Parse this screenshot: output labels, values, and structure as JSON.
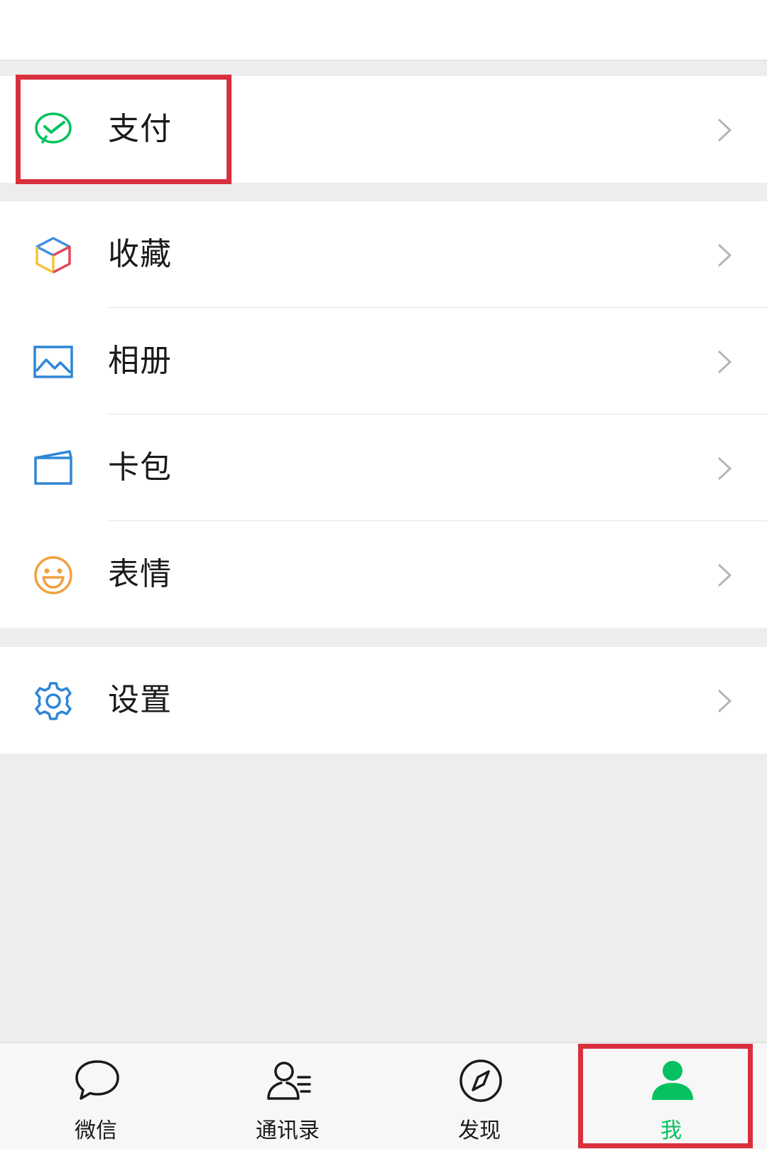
{
  "colors": {
    "accent_green": "#07c160",
    "highlight_red": "#d9303e",
    "text": "#1a1a1a",
    "chevron": "#b5b5b5"
  },
  "menu": {
    "pay": {
      "label": "支付",
      "icon": "wechat-pay-icon"
    },
    "favorites": {
      "label": "收藏",
      "icon": "cube-icon"
    },
    "album": {
      "label": "相册",
      "icon": "image-icon"
    },
    "cards": {
      "label": "卡包",
      "icon": "card-wallet-icon"
    },
    "stickers": {
      "label": "表情",
      "icon": "smiley-icon"
    },
    "settings": {
      "label": "设置",
      "icon": "gear-icon"
    }
  },
  "tabbar": {
    "tabs": [
      {
        "label": "微信",
        "icon": "chat-bubble-icon",
        "active": false
      },
      {
        "label": "通讯录",
        "icon": "contacts-icon",
        "active": false
      },
      {
        "label": "发现",
        "icon": "compass-icon",
        "active": false
      },
      {
        "label": "我",
        "icon": "person-icon",
        "active": true
      }
    ]
  }
}
